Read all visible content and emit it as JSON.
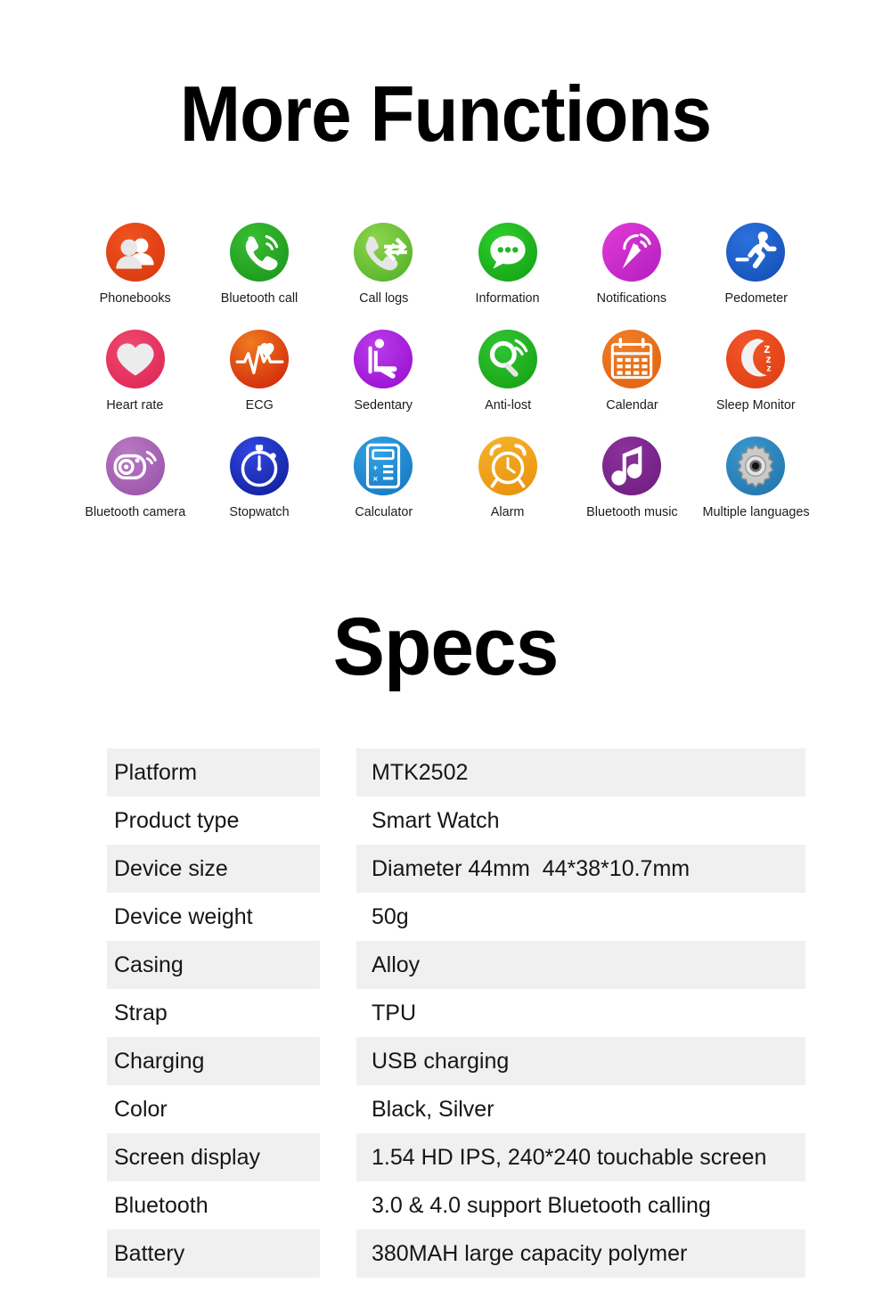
{
  "sections": {
    "functions_title": "More Functions",
    "specs_title": "Specs"
  },
  "features": [
    {
      "label": "Phonebooks",
      "icon": "contacts-icon",
      "color": "#e8441a"
    },
    {
      "label": "Bluetooth call",
      "icon": "phone-call-icon",
      "color": "#2aa828"
    },
    {
      "label": "Call logs",
      "icon": "call-logs-icon",
      "color": "#6cc23c"
    },
    {
      "label": "Information",
      "icon": "chat-bubble-icon",
      "color": "#1eb91e"
    },
    {
      "label": "Notifications",
      "icon": "satellite-dish-icon",
      "color": "#cf22c8"
    },
    {
      "label": "Pedometer",
      "icon": "running-person-icon",
      "color": "#1a5fd0"
    },
    {
      "label": "Heart rate",
      "icon": "heart-icon",
      "color": "#ed3a63"
    },
    {
      "label": "ECG",
      "icon": "ecg-waveform-icon",
      "color": "#df3c10"
    },
    {
      "label": "Sedentary",
      "icon": "sitting-person-icon",
      "color": "#ac1ae0"
    },
    {
      "label": "Anti-lost",
      "icon": "magnifier-signal-icon",
      "color": "#24b524"
    },
    {
      "label": "Calendar",
      "icon": "calendar-icon",
      "color": "#e8701a"
    },
    {
      "label": "Sleep Monitor",
      "icon": "moon-zzz-icon",
      "color": "#e8481a"
    },
    {
      "label": "Bluetooth camera",
      "icon": "camera-icon",
      "color": "#a864b4"
    },
    {
      "label": "Stopwatch",
      "icon": "stopwatch-icon",
      "color": "#1b32c4"
    },
    {
      "label": "Calculator",
      "icon": "calculator-icon",
      "color": "#1f8fd4"
    },
    {
      "label": "Alarm",
      "icon": "alarm-clock-icon",
      "color": "#efa017"
    },
    {
      "label": "Bluetooth music",
      "icon": "music-note-icon",
      "color": "#7d2a8f"
    },
    {
      "label": "Multiple languages",
      "icon": "gear-icon",
      "color": "#2b86bd"
    }
  ],
  "specs": [
    {
      "key": "Platform",
      "value": "MTK2502"
    },
    {
      "key": "Product type",
      "value": "Smart Watch"
    },
    {
      "key": "Device size",
      "value": "Diameter 44mm  44*38*10.7mm"
    },
    {
      "key": "Device weight",
      "value": "50g"
    },
    {
      "key": "Casing",
      "value": "Alloy"
    },
    {
      "key": "Strap",
      "value": "TPU"
    },
    {
      "key": "Charging",
      "value": "USB charging"
    },
    {
      "key": "Color",
      "value": "Black, Silver"
    },
    {
      "key": "Screen display",
      "value": "1.54 HD IPS, 240*240 touchable screen"
    },
    {
      "key": "Bluetooth",
      "value": "3.0 & 4.0 support Bluetooth calling"
    },
    {
      "key": "Battery",
      "value": "380MAH large capacity polymer"
    }
  ]
}
